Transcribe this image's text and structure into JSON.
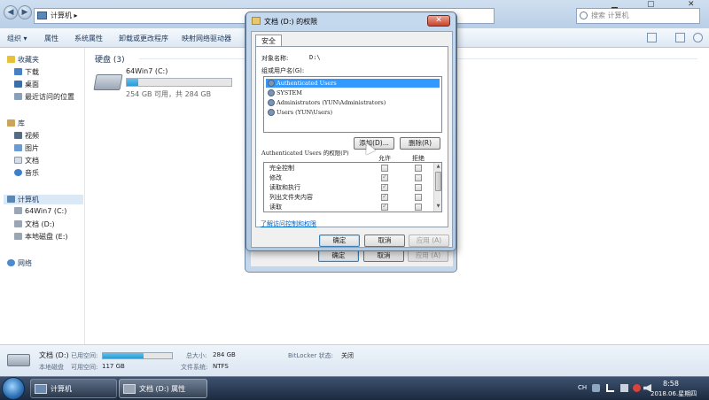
{
  "explorer": {
    "address_path": "计算机 ▸",
    "search_placeholder": "搜索 计算机",
    "commands": [
      "组织 ▾",
      "属性",
      "系统属性",
      "卸载或更改程序",
      "映射网络驱动器"
    ],
    "nav": {
      "favorites": "收藏夹",
      "favorite_items": [
        "下载",
        "桌面",
        "最近访问的位置"
      ],
      "libraries": "库",
      "library_items": [
        "视频",
        "图片",
        "文档",
        "音乐"
      ],
      "computer": "计算机",
      "computer_items": [
        "64Win7 (C:)",
        "文档 (D:)",
        "本地磁盘 (E:)"
      ],
      "network": "网络"
    },
    "hard_disks_header": "硬盘 (3)",
    "drive": {
      "name": "64Win7 (C:)",
      "free_text": "254 GB 可用，共 284 GB",
      "used_fraction": 0.11
    },
    "details": {
      "drive_name": "文档 (D:)",
      "used_label": "已用空间:",
      "type_label": "本地磁盘",
      "free_label": "可用空间:",
      "free_value": "117 GB",
      "total_label": "总大小:",
      "total_value": "284 GB",
      "fs_label": "文件系统:",
      "fs_value": "NTFS",
      "bitlocker_label": "BitLocker 状态:",
      "bitlocker_value": "关闭",
      "used_fraction": 0.59
    }
  },
  "props_dialog": {
    "ok": "确定",
    "cancel": "取消",
    "apply": "应用 (A)"
  },
  "security_dialog": {
    "title": "文档 (D:) 的权限",
    "close": "✕",
    "tab": "安全",
    "object_label": "对象名称:",
    "object_value": "D:\\",
    "group_label": "组或用户名(G):",
    "users": [
      "Authenticated Users",
      "SYSTEM",
      "Administrators (YUN\\Administrators)",
      "Users (YUN\\Users)"
    ],
    "selected_user_index": 0,
    "add_button": "添加(D)...",
    "remove_button": "删除(R)",
    "permissions_label": "Authenticated Users 的权限(P)",
    "allow_header": "允许",
    "deny_header": "拒绝",
    "permissions": [
      {
        "name": "完全控制",
        "allow": false,
        "deny": false
      },
      {
        "name": "修改",
        "allow": true,
        "deny": false
      },
      {
        "name": "读取和执行",
        "allow": true,
        "deny": false
      },
      {
        "name": "列出文件夹内容",
        "allow": true,
        "deny": false
      },
      {
        "name": "读取",
        "allow": true,
        "deny": false
      }
    ],
    "advanced_link": "了解访问控制和权限",
    "ok": "确定",
    "cancel": "取消",
    "apply": "应用 (A)"
  },
  "taskbar": {
    "explorer_label": "计算机",
    "props_label": "文档 (D:) 属性",
    "lang": "CH",
    "time": "8:58",
    "date": "2018.06.星期四"
  }
}
